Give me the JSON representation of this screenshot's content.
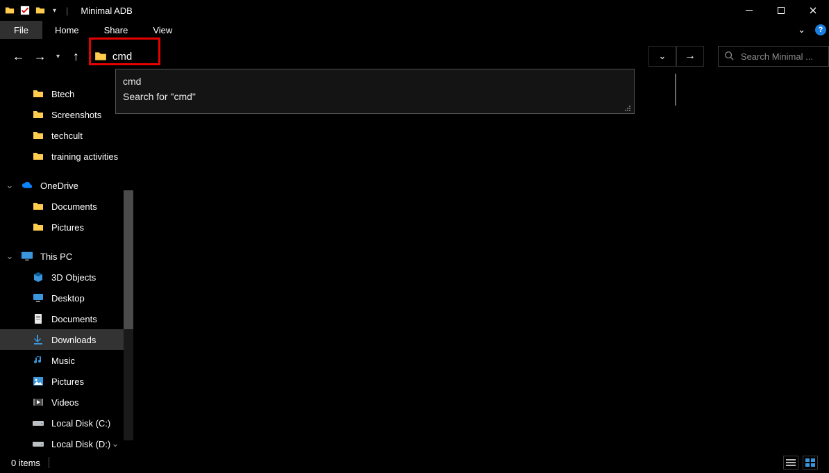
{
  "titlebar": {
    "separator": "|",
    "dropdown_glyph": "▾",
    "app_title": "Minimal ADB"
  },
  "ribbon": {
    "file": "File",
    "tabs": [
      "Home",
      "Share",
      "View"
    ],
    "help_glyph": "?",
    "expand_glyph": "⌄"
  },
  "nav": {
    "back": "←",
    "forward": "→",
    "recent": "▾",
    "up": "↑",
    "address_value": "cmd",
    "history_glyph": "⌄",
    "refresh_glyph": "→",
    "search_placeholder": "Search Minimal ..."
  },
  "address_dropdown": {
    "suggest1": "cmd",
    "suggest2": "Search for \"cmd\""
  },
  "navpane": {
    "quick": [
      {
        "label": "Btech"
      },
      {
        "label": "Screenshots"
      },
      {
        "label": "techcult"
      },
      {
        "label": "training activities"
      }
    ],
    "onedrive": {
      "label": "OneDrive",
      "children": [
        {
          "label": "Documents"
        },
        {
          "label": "Pictures"
        }
      ]
    },
    "thispc": {
      "label": "This PC",
      "children": [
        {
          "label": "3D Objects",
          "icon": "3d"
        },
        {
          "label": "Desktop",
          "icon": "desktop"
        },
        {
          "label": "Documents",
          "icon": "documents"
        },
        {
          "label": "Downloads",
          "icon": "downloads",
          "selected": true
        },
        {
          "label": "Music",
          "icon": "music"
        },
        {
          "label": "Pictures",
          "icon": "pictures"
        },
        {
          "label": "Videos",
          "icon": "videos"
        },
        {
          "label": "Local Disk (C:)",
          "icon": "drive"
        },
        {
          "label": "Local Disk (D:)",
          "icon": "drive"
        }
      ]
    }
  },
  "statusbar": {
    "items_text": "0 items"
  }
}
